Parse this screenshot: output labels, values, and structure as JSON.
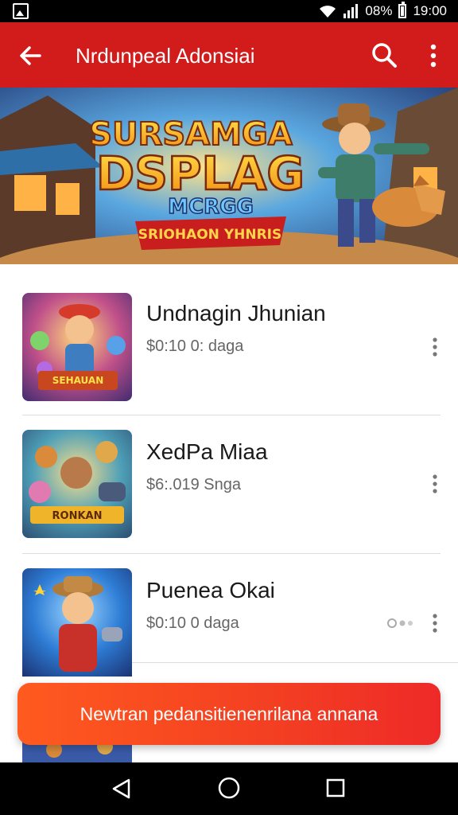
{
  "status_bar": {
    "battery_text": "08%",
    "time": "19:00"
  },
  "app_bar": {
    "title": "Nrdunpeal Adonsiai",
    "icons": [
      "back-arrow-icon",
      "search-icon",
      "more-vert-icon"
    ]
  },
  "banner": {
    "title_line1": "SURSAMGA",
    "title_line2": "DSPLAG",
    "title_line3": "MCRGG",
    "subtitle": "SRIOHAON YHNRIS"
  },
  "games": [
    {
      "title": "Undnagin Jhunian",
      "subtitle": "$0:10 0: daga",
      "thumb_label": "SEHAUAN",
      "has_progress": false
    },
    {
      "title": "XedPa Miaa",
      "subtitle": "$6:.019 Snga",
      "thumb_label": "RONKAN",
      "has_progress": false
    },
    {
      "title": "Puenea Okai",
      "subtitle": "$0:10 0 daga",
      "thumb_label": "",
      "has_progress": true
    }
  ],
  "cta": {
    "label": "Newtran pedansitienenrilana annana"
  },
  "colors": {
    "app_bar": "#d21c1c",
    "cta_start": "#ff5a1f",
    "cta_end": "#ee2a28"
  }
}
